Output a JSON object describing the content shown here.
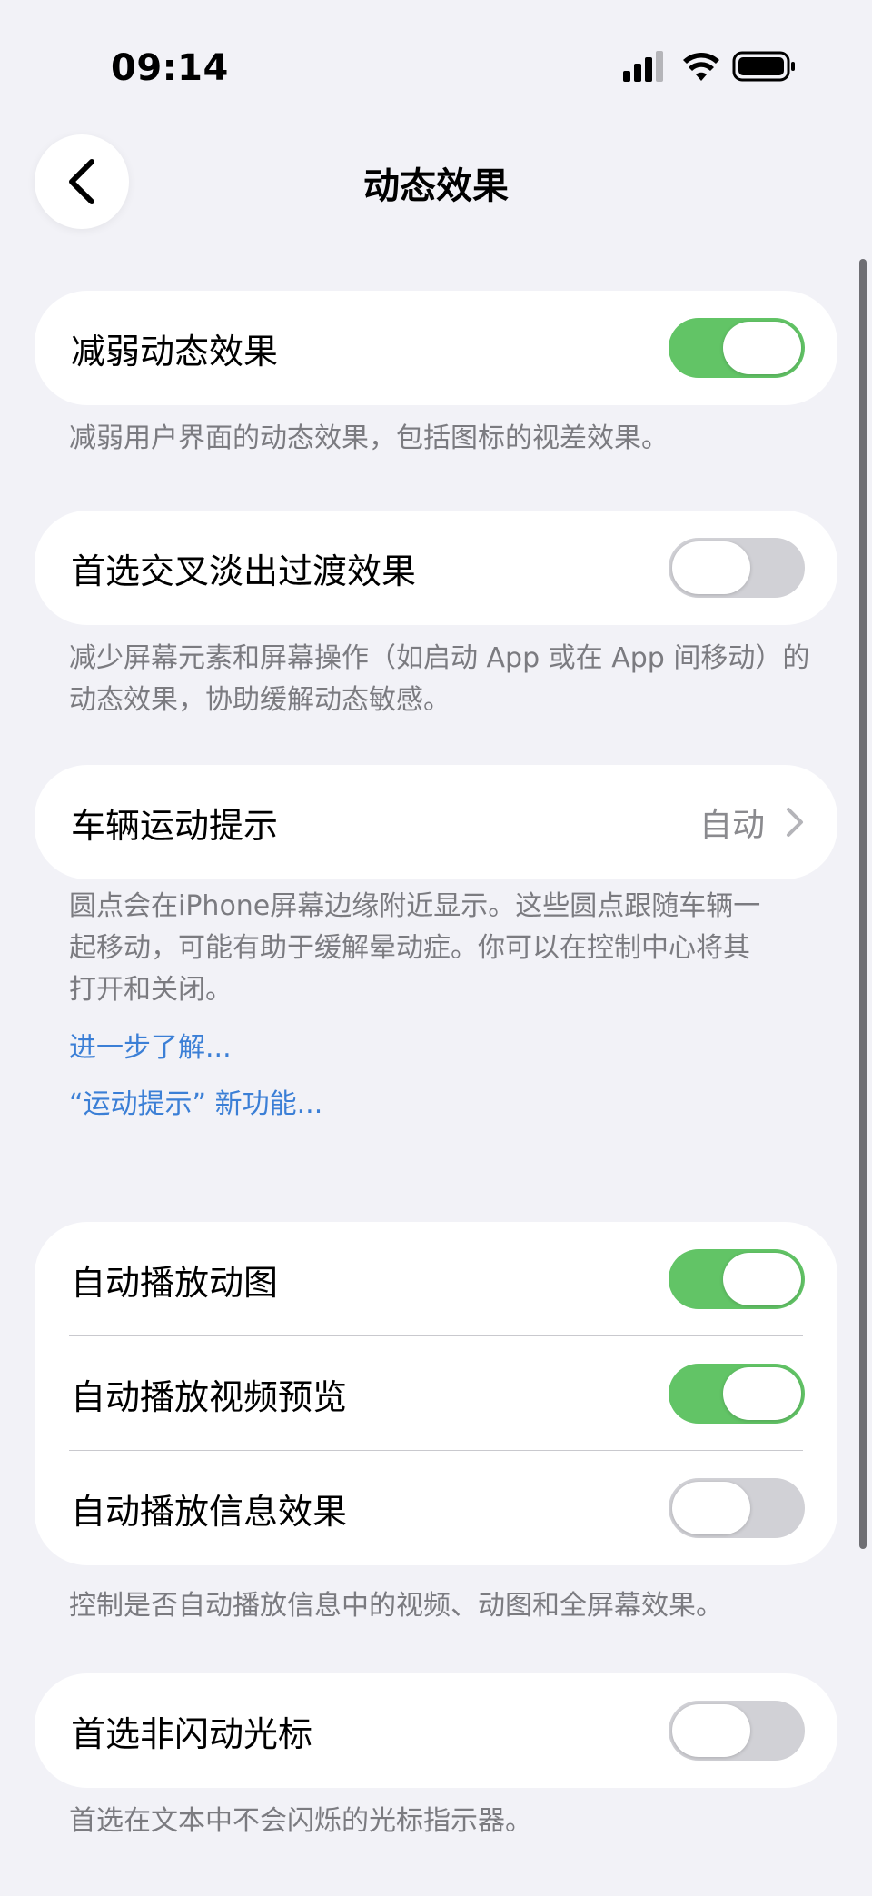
{
  "status_bar": {
    "time": "09:14"
  },
  "nav": {
    "title": "动态效果"
  },
  "sections": [
    {
      "label": "减弱动态效果",
      "on": true,
      "footer": "减弱用户界面的动态效果，包括图标的视差效果。"
    },
    {
      "label": "首选交叉淡出过渡效果",
      "on": false,
      "footer_lines": [
        "减少屏幕元素和屏幕操作（如启动 App 或在 App 间移动）的",
        "动态效果，协助缓解动态敏感。"
      ]
    },
    {
      "label": "车辆运动提示",
      "value": "自动",
      "footer_lines": [
        "圆点会在iPhone屏幕边缘附近显示。这些圆点跟随车辆一",
        "起移动，可能有助于缓解晕动症。你可以在控制中心将其",
        "打开和关闭。"
      ],
      "links": [
        "进一步了解...",
        "“运动提示” 新功能..."
      ]
    }
  ],
  "autoplay_group": {
    "rows": [
      {
        "label": "自动播放动图",
        "on": true
      },
      {
        "label": "自动播放视频预览",
        "on": true
      },
      {
        "label": "自动播放信息效果",
        "on": false
      }
    ],
    "footer": "控制是否自动播放信息中的视频、动图和全屏幕效果。"
  },
  "cursor_section": {
    "label": "首选非闪动光标",
    "on": false,
    "footer": "首选在文本中不会闪烁的光标指示器。"
  },
  "colors": {
    "toggle_on": "#62c466",
    "toggle_off": "#d1d1d6",
    "link": "#3b7fd6",
    "background": "#f2f2f7"
  }
}
